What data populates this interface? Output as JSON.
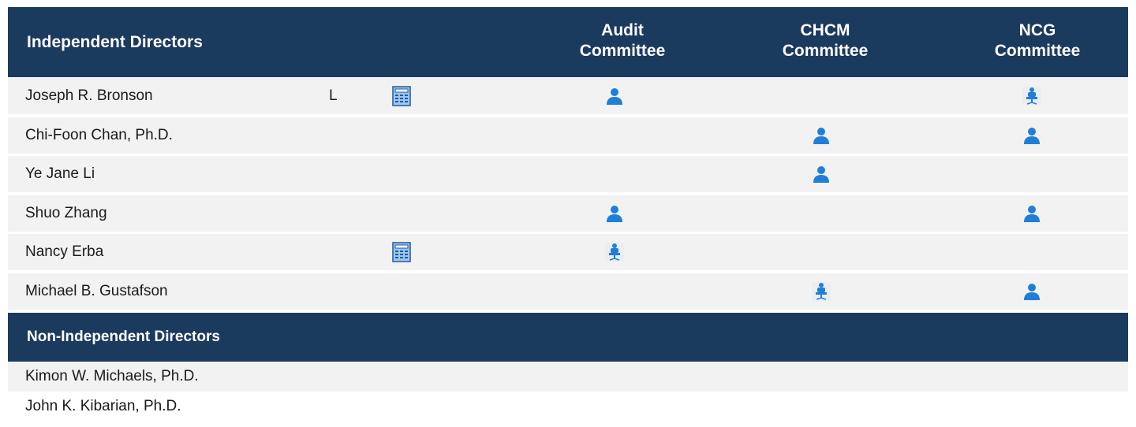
{
  "header": {
    "title": "Independent Directors",
    "columns": [
      {
        "line1": "Audit",
        "line2": "Committee"
      },
      {
        "line1": "CHCM",
        "line2": "Committee"
      },
      {
        "line1": "NCG",
        "line2": "Committee"
      }
    ]
  },
  "independent_directors": [
    {
      "name": "Joseph R. Bronson",
      "lead": "L",
      "financial_expert": true,
      "audit": "member",
      "chcm": "",
      "ncg": "chair"
    },
    {
      "name": "Chi-Foon Chan, Ph.D.",
      "lead": "",
      "financial_expert": false,
      "audit": "",
      "chcm": "member",
      "ncg": "member"
    },
    {
      "name": "Ye Jane Li",
      "lead": "",
      "financial_expert": false,
      "audit": "",
      "chcm": "member",
      "ncg": ""
    },
    {
      "name": "Shuo Zhang",
      "lead": "",
      "financial_expert": false,
      "audit": "member",
      "chcm": "",
      "ncg": "member"
    },
    {
      "name": "Nancy Erba",
      "lead": "",
      "financial_expert": true,
      "audit": "chair",
      "chcm": "",
      "ncg": ""
    },
    {
      "name": "Michael B. Gustafson",
      "lead": "",
      "financial_expert": false,
      "audit": "",
      "chcm": "chair",
      "ncg": "member"
    }
  ],
  "non_independent": {
    "title": "Non-Independent Directors",
    "directors": [
      "Kimon W. Michaels, Ph.D.",
      "John K. Kibarian, Ph.D."
    ]
  },
  "colors": {
    "header_bg": "#1a3a5e",
    "row_bg": "#f2f2f2",
    "icon_blue": "#1f7fd8"
  },
  "icons": {
    "member": "person-icon",
    "chair": "chair-icon",
    "financial_expert": "calculator-icon"
  }
}
